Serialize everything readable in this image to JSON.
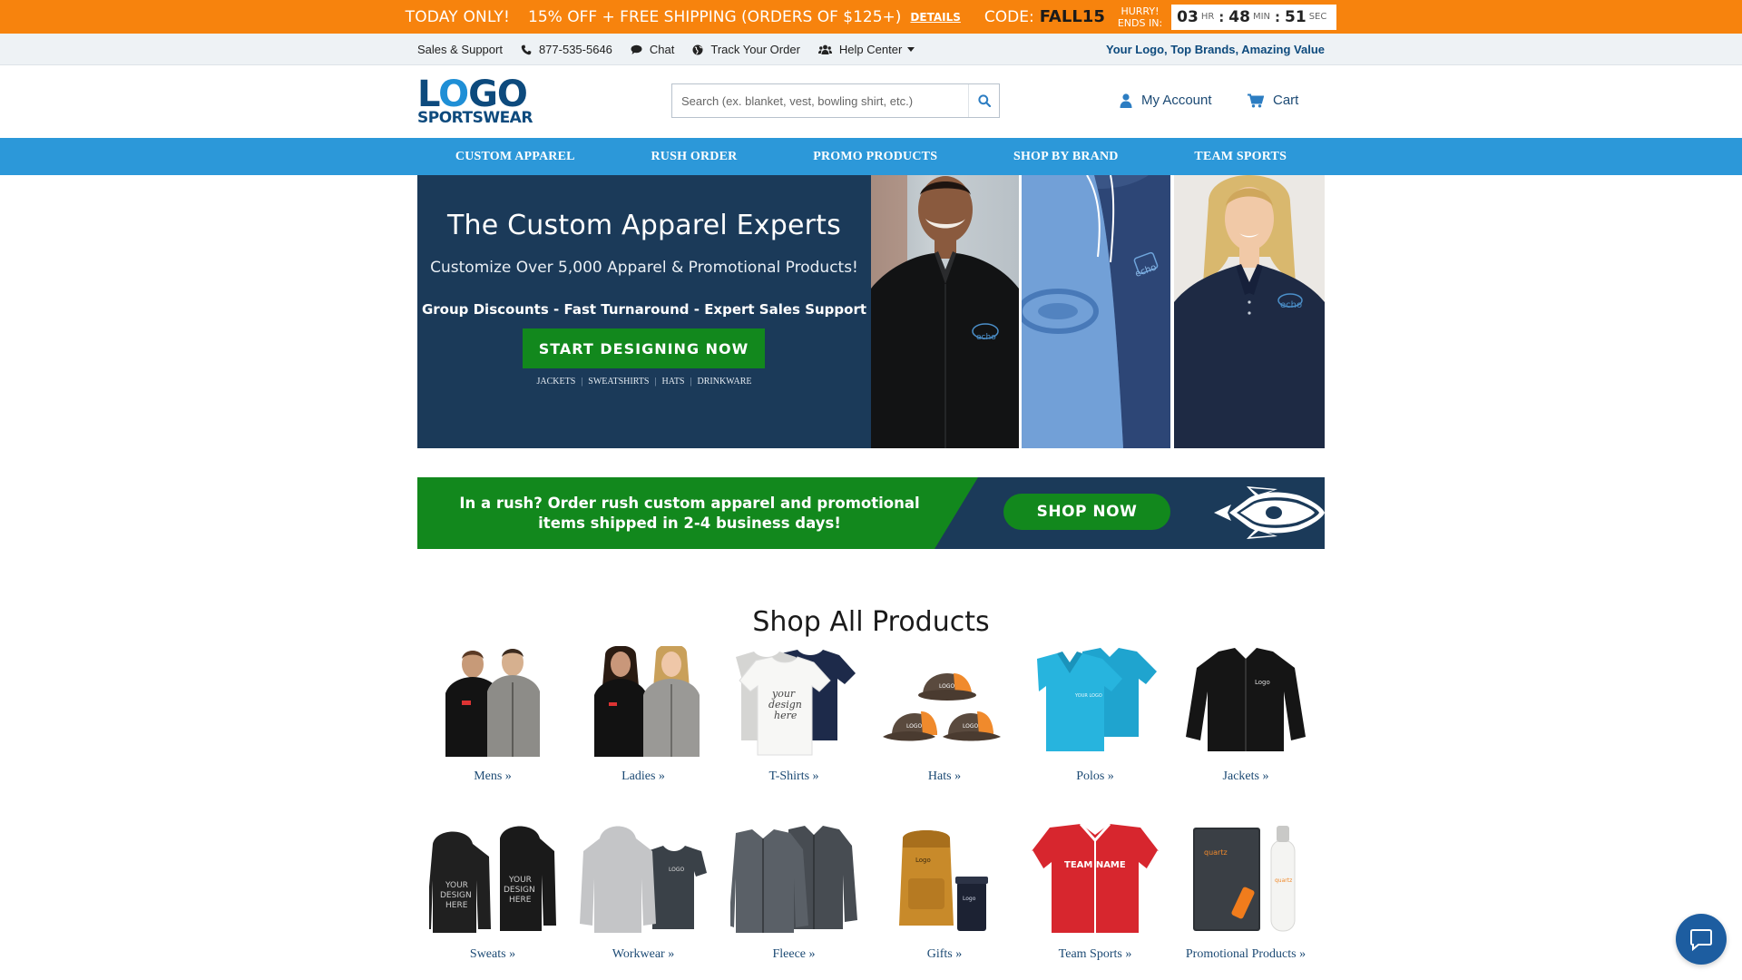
{
  "promo": {
    "today": "TODAY ONLY!",
    "offer": "15% OFF + FREE SHIPPING (ORDERS OF $125+)",
    "details": "DETAILS",
    "code_label": "CODE:",
    "code": "FALL15",
    "hurry_line1": "HURRY!",
    "hurry_line2": "ENDS IN:",
    "timer": {
      "hr": "03",
      "hr_unit": "HR",
      "min": "48",
      "min_unit": "MIN",
      "sec": "51",
      "sec_unit": "SEC"
    }
  },
  "util": {
    "sales": "Sales & Support",
    "phone": "877-535-5646",
    "chat": "Chat",
    "track": "Track Your Order",
    "help": "Help Center",
    "tagline": "Your Logo, Top Brands, Amazing Value"
  },
  "header": {
    "logo_line1_a": "L",
    "logo_line1_o": "O",
    "logo_line1_b": "GO",
    "logo_line2": "SPORTSWEAR",
    "search_placeholder": "Search (ex. blanket, vest, bowling shirt, etc.)",
    "account": "My Account",
    "cart": "Cart"
  },
  "nav": [
    "CUSTOM APPAREL",
    "RUSH ORDER",
    "PROMO PRODUCTS",
    "SHOP BY BRAND",
    "TEAM SPORTS"
  ],
  "hero": {
    "title": "The Custom Apparel Experts",
    "subtitle": "Customize Over 5,000 Apparel & Promotional Products!",
    "features": "Group Discounts - Fast Turnaround - Expert Sales Support",
    "cta": "START DESIGNING NOW",
    "links": [
      "JACKETS",
      "SWEATSHIRTS",
      "HATS",
      "DRINKWARE"
    ],
    "brand_on_shirt": "echo"
  },
  "rush": {
    "text": "In a rush? Order rush custom apparel and promotional items shipped in 2-4 business days!",
    "button": "SHOP NOW"
  },
  "shop": {
    "title": "Shop All Products",
    "products": [
      "Mens »",
      "Ladies »",
      "T-Shirts »",
      "Hats »",
      "Polos »",
      "Jackets »",
      "Sweats »",
      "Workwear »",
      "Fleece »",
      "Gifts »",
      "Team Sports »",
      "Promotional Products »"
    ]
  },
  "colors": {
    "promo": "#f7830d",
    "nav": "#2c98d9",
    "navy": "#1b3a59",
    "green": "#12881d",
    "link": "#1c4a74"
  }
}
